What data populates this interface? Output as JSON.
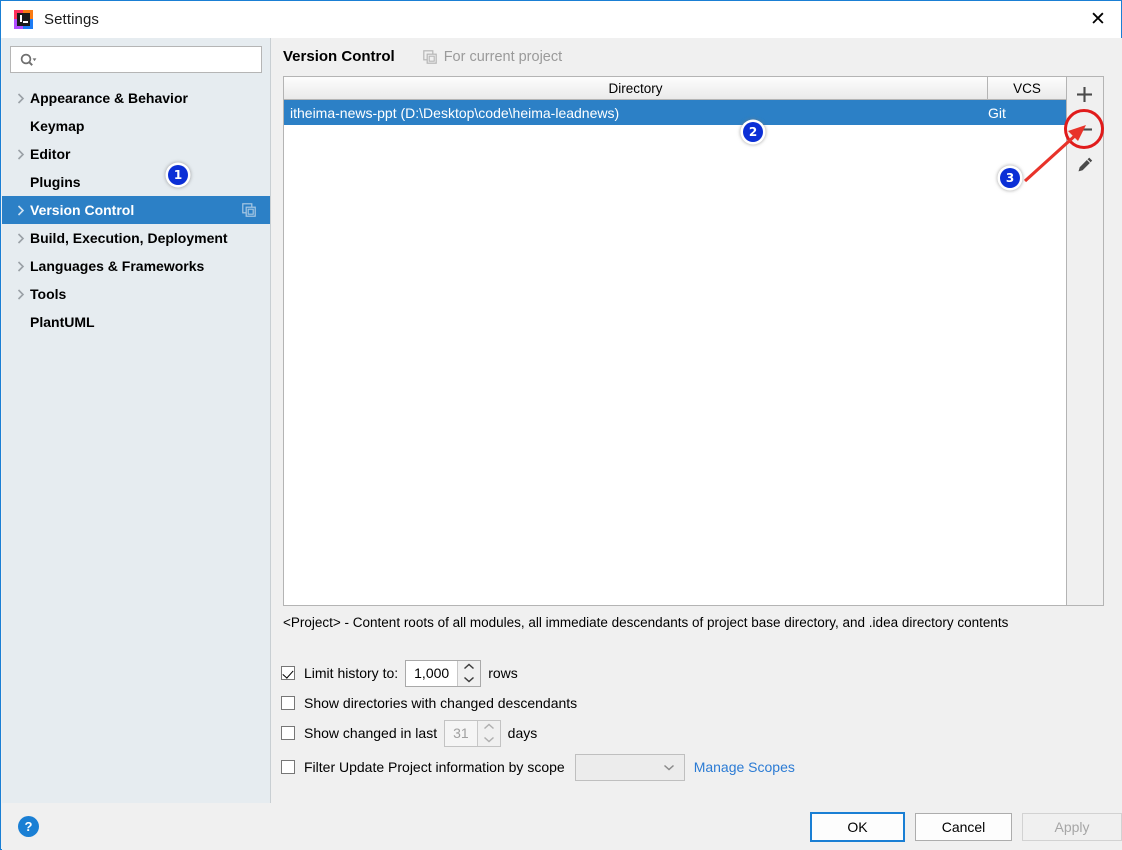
{
  "window": {
    "title": "Settings",
    "logo_icon": "intellij-idea-logo",
    "close_icon": "close-icon"
  },
  "sidebar": {
    "search": {
      "placeholder": "",
      "value": "",
      "icon": "search-icon"
    },
    "items": [
      {
        "label": "Appearance & Behavior",
        "expandable": true,
        "selected": false
      },
      {
        "label": "Keymap",
        "expandable": false,
        "selected": false
      },
      {
        "label": "Editor",
        "expandable": true,
        "selected": false
      },
      {
        "label": "Plugins",
        "expandable": false,
        "selected": false
      },
      {
        "label": "Version Control",
        "expandable": true,
        "selected": true
      },
      {
        "label": "Build, Execution, Deployment",
        "expandable": true,
        "selected": false
      },
      {
        "label": "Languages & Frameworks",
        "expandable": true,
        "selected": false
      },
      {
        "label": "Tools",
        "expandable": true,
        "selected": false
      },
      {
        "label": "PlantUML",
        "expandable": false,
        "selected": false
      }
    ]
  },
  "main": {
    "page_title": "Version Control",
    "for_current_project": "For current project",
    "for_current_project_icon": "stacked-pages-icon",
    "table": {
      "columns": [
        "Directory",
        "VCS"
      ],
      "rows": [
        {
          "directory": "itheima-news-ppt (D:\\Desktop\\code\\heima-leadnews)",
          "vcs": "Git",
          "selected": true
        }
      ]
    },
    "toolbar": {
      "add_label": "+",
      "remove_label": "−",
      "edit_label": "edit"
    },
    "description": "<Project> - Content roots of all modules, all immediate descendants of project base directory, and .idea directory contents",
    "options": {
      "limit_history": {
        "label": "Limit history to:",
        "checked": true,
        "value": "1,000",
        "suffix": "rows"
      },
      "show_directories": {
        "label": "Show directories with changed descendants",
        "checked": false
      },
      "show_changed_in_last": {
        "label": "Show changed in last",
        "checked": false,
        "value": "31",
        "suffix": "days"
      },
      "filter_by_scope": {
        "label": "Filter Update Project information by scope",
        "checked": false,
        "scope_value": "",
        "link": "Manage Scopes"
      }
    }
  },
  "footer": {
    "help_label": "?",
    "ok_label": "OK",
    "cancel_label": "Cancel",
    "apply_label": "Apply"
  },
  "annotations": {
    "badges": [
      {
        "label": "1"
      },
      {
        "label": "2"
      },
      {
        "label": "3"
      }
    ],
    "highlight_color": "#e01b1b"
  },
  "colors": {
    "accent": "#2c80c6",
    "link": "#2b7bd4",
    "badge": "#0b2fd6",
    "sidebar_bg": "#e6ecf0"
  }
}
